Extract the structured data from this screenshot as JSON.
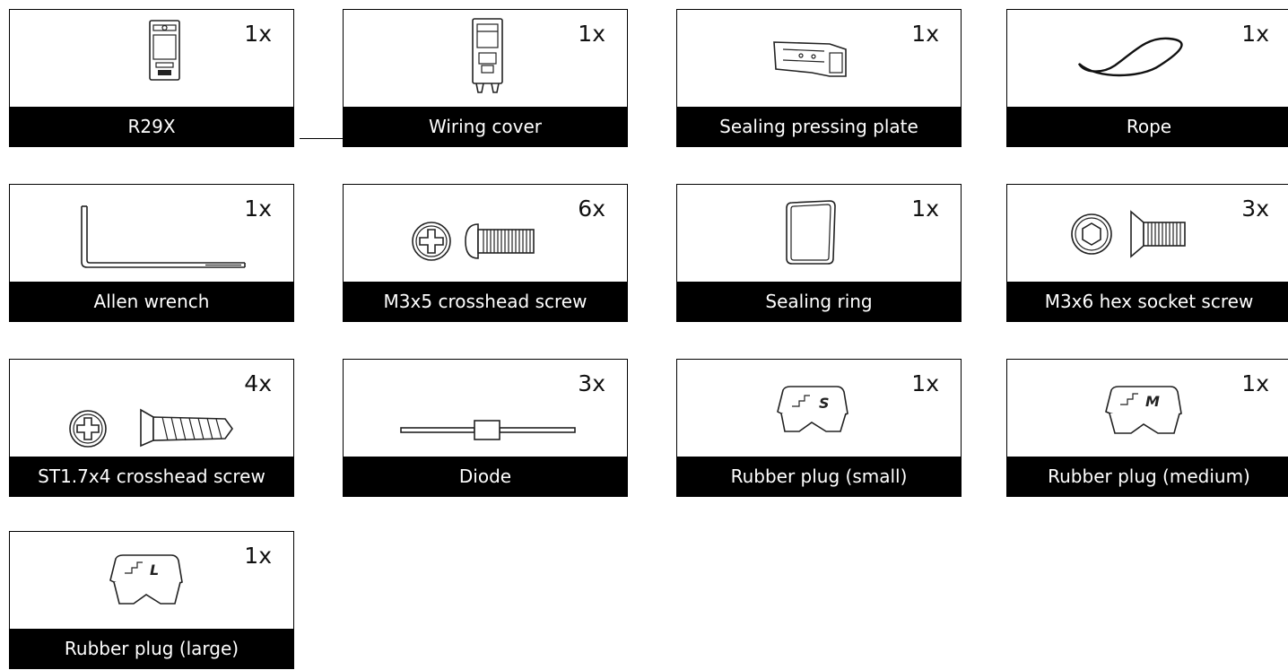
{
  "items": [
    {
      "qty": "1x",
      "label": "R29X",
      "icon": "intercom-device-icon"
    },
    {
      "qty": "1x",
      "label": "Wiring cover",
      "icon": "wiring-cover-icon"
    },
    {
      "qty": "1x",
      "label": "Sealing pressing plate",
      "icon": "pressing-plate-icon"
    },
    {
      "qty": "1x",
      "label": "Rope",
      "icon": "rope-icon"
    },
    {
      "qty": "1x",
      "label": "Allen wrench",
      "icon": "allen-wrench-icon"
    },
    {
      "qty": "6x",
      "label": "M3x5 crosshead screw",
      "icon": "crosshead-screw-icon"
    },
    {
      "qty": "1x",
      "label": "Sealing ring",
      "icon": "sealing-ring-icon"
    },
    {
      "qty": "3x",
      "label": "M3x6 hex socket screw",
      "icon": "hex-socket-screw-icon"
    },
    {
      "qty": "4x",
      "label": "ST1.7x4 crosshead screw",
      "icon": "self-tapping-screw-icon"
    },
    {
      "qty": "3x",
      "label": "Diode",
      "icon": "diode-icon"
    },
    {
      "qty": "1x",
      "label": "Rubber plug (small)",
      "icon": "rubber-plug-small-icon",
      "mark": "S"
    },
    {
      "qty": "1x",
      "label": "Rubber plug (medium)",
      "icon": "rubber-plug-medium-icon",
      "mark": "M"
    },
    {
      "qty": "1x",
      "label": "Rubber plug (large)",
      "icon": "rubber-plug-large-icon",
      "mark": "L"
    }
  ]
}
